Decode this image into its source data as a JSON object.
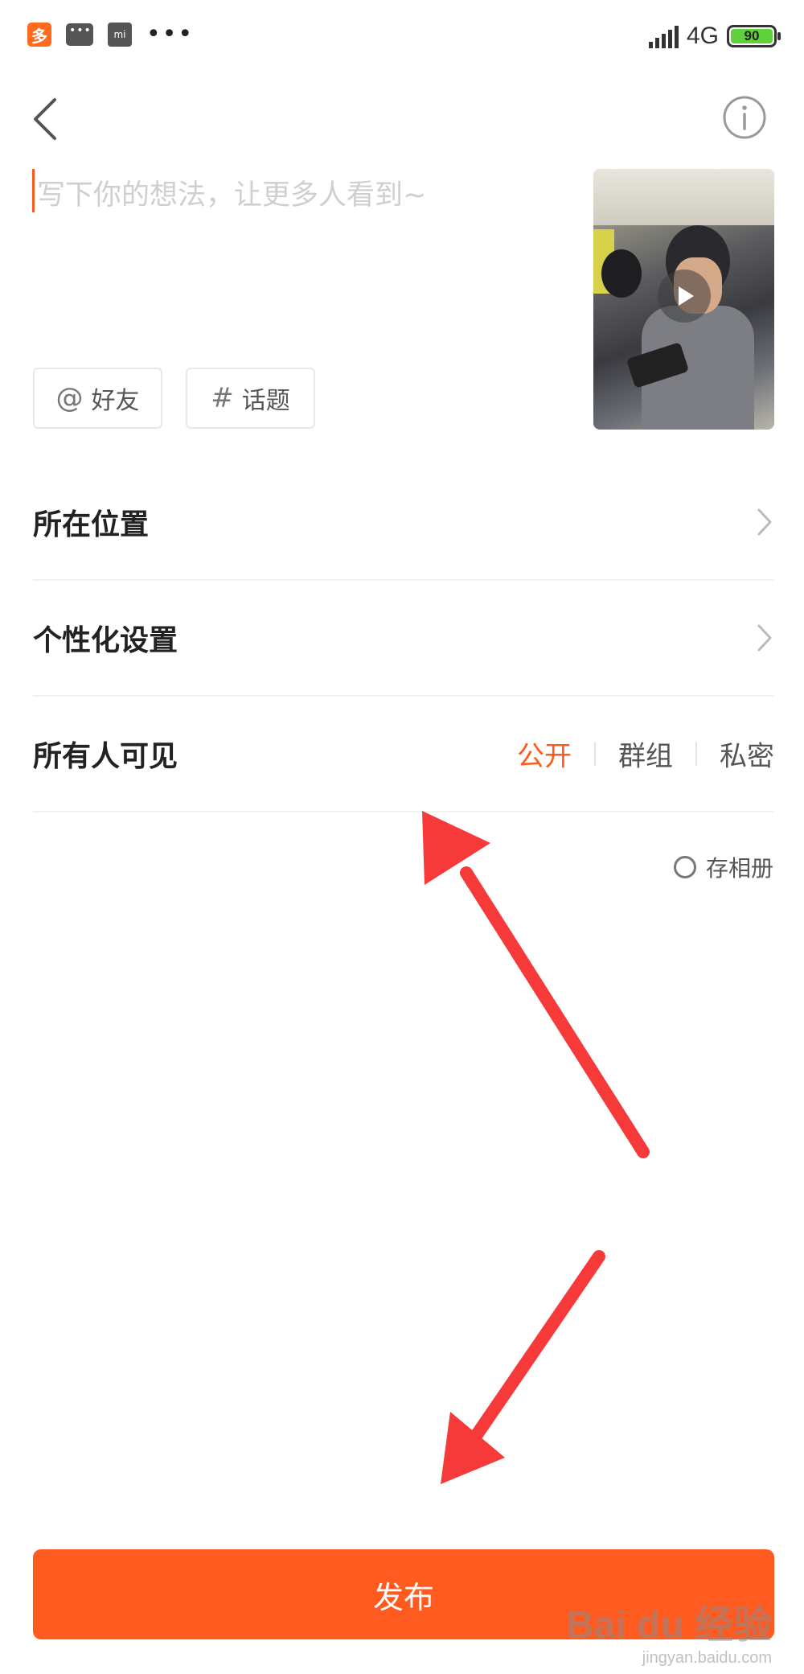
{
  "status_bar": {
    "network": "4G",
    "battery": "90",
    "app_icon_text": "多",
    "bag_icon_text": "mi",
    "more": "•••"
  },
  "composer": {
    "placeholder": "写下你的想法，让更多人看到~",
    "chips": [
      {
        "symbol": "@",
        "label": "好友"
      },
      {
        "symbol": "#",
        "label": "话题"
      }
    ]
  },
  "settings": {
    "location_label": "所在位置",
    "personalize_label": "个性化设置",
    "visibility_label": "所有人可见",
    "visibility_options": [
      "公开",
      "群组",
      "私密"
    ],
    "visibility_selected": "公开",
    "save_album_label": "存相册"
  },
  "footer": {
    "publish_label": "发布"
  },
  "watermark": {
    "main": "Bai du 经验",
    "sub": "jingyan.baidu.com"
  },
  "colors": {
    "accent": "#ff5a1f",
    "annotation_arrow": "#f63a3a"
  },
  "icons": [
    "back-icon",
    "info-icon",
    "play-icon",
    "chevron-right-icon",
    "radio-icon",
    "at-icon",
    "hash-icon"
  ]
}
